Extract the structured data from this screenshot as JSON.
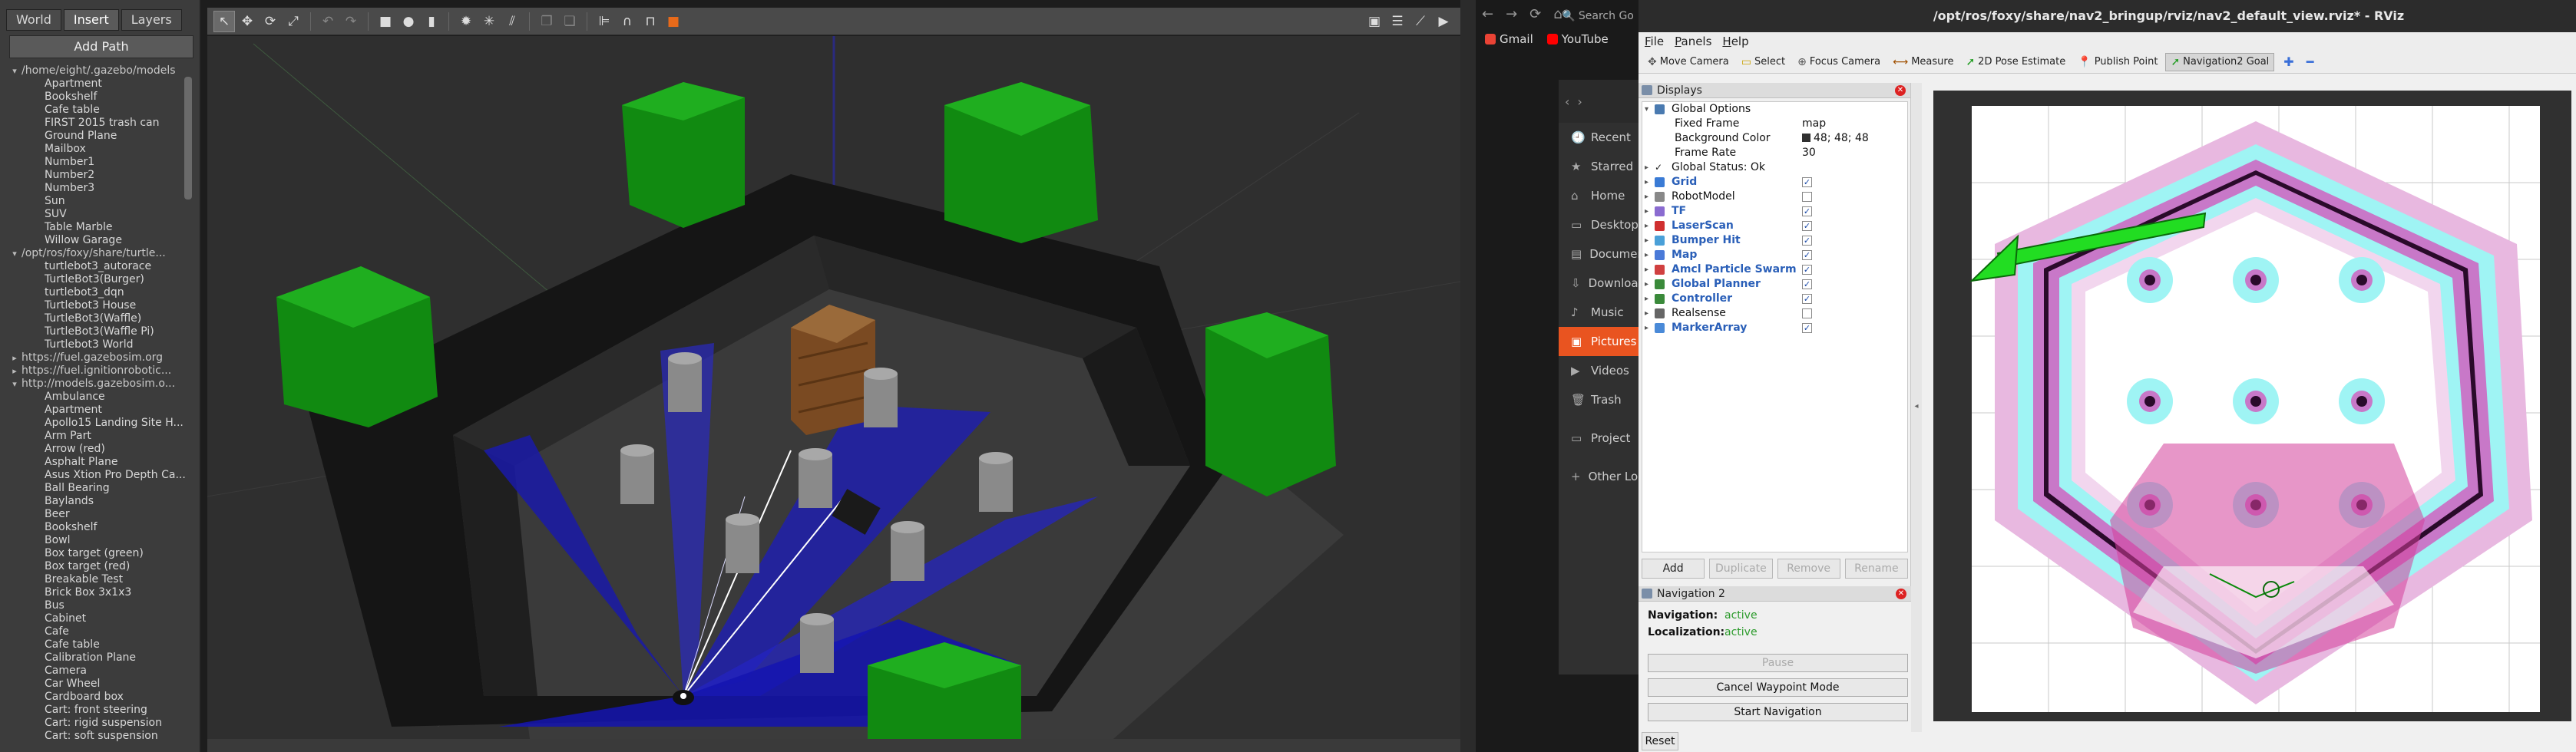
{
  "gazebo": {
    "tabs": [
      {
        "label": "World"
      },
      {
        "label": "Insert"
      },
      {
        "label": "Layers"
      }
    ],
    "add_path_label": "Add Path",
    "tree": [
      {
        "label": "/home/eight/.gazebo/models",
        "root": true
      },
      {
        "label": "Apartment"
      },
      {
        "label": "Bookshelf"
      },
      {
        "label": "Cafe table"
      },
      {
        "label": "FIRST 2015 trash can"
      },
      {
        "label": "Ground Plane"
      },
      {
        "label": "Mailbox"
      },
      {
        "label": "Number1"
      },
      {
        "label": "Number2"
      },
      {
        "label": "Number3"
      },
      {
        "label": "Sun"
      },
      {
        "label": "SUV"
      },
      {
        "label": "Table Marble"
      },
      {
        "label": "Willow Garage"
      },
      {
        "label": "/opt/ros/foxy/share/turtle...",
        "root": true
      },
      {
        "label": "turtlebot3_autorace"
      },
      {
        "label": "TurtleBot3(Burger)"
      },
      {
        "label": "turtlebot3_dqn"
      },
      {
        "label": "Turtlebot3 House"
      },
      {
        "label": "TurtleBot3(Waffle)"
      },
      {
        "label": "TurtleBot3(Waffle Pi)"
      },
      {
        "label": "Turtlebot3 World"
      },
      {
        "label": "https://fuel.gazebosim.org",
        "root": true,
        "collapsed": true
      },
      {
        "label": "https://fuel.ignitionrobotic...",
        "root": true,
        "collapsed": true
      },
      {
        "label": "http://models.gazebosim.o...",
        "root": true
      },
      {
        "label": "Ambulance"
      },
      {
        "label": "Apartment"
      },
      {
        "label": "Apollo15 Landing Site H..."
      },
      {
        "label": "Arm Part"
      },
      {
        "label": "Arrow (red)"
      },
      {
        "label": "Asphalt Plane"
      },
      {
        "label": "Asus Xtion Pro Depth Ca..."
      },
      {
        "label": "Ball Bearing"
      },
      {
        "label": "Baylands"
      },
      {
        "label": "Beer"
      },
      {
        "label": "Bookshelf"
      },
      {
        "label": "Bowl"
      },
      {
        "label": "Box target (green)"
      },
      {
        "label": "Box target (red)"
      },
      {
        "label": "Breakable Test"
      },
      {
        "label": "Brick Box 3x1x3"
      },
      {
        "label": "Bus"
      },
      {
        "label": "Cabinet"
      },
      {
        "label": "Cafe"
      },
      {
        "label": "Cafe table"
      },
      {
        "label": "Calibration Plane"
      },
      {
        "label": "Camera"
      },
      {
        "label": "Car Wheel"
      },
      {
        "label": "Cardboard box"
      },
      {
        "label": "Cart: front steering"
      },
      {
        "label": "Cart: rigid suspension"
      },
      {
        "label": "Cart: soft suspension"
      }
    ],
    "toolbar_icons": [
      "arrow-select-icon",
      "translate-icon",
      "rotate-icon",
      "scale-icon",
      "undo-icon",
      "redo-icon",
      "box-icon",
      "sphere-icon",
      "cylinder-icon",
      "sun-icon",
      "spot-light-icon",
      "dir-light-icon",
      "copy-icon",
      "paste-icon",
      "align-icon",
      "snap-icon",
      "joint-icon",
      "color-icon"
    ],
    "toolbar_right_icons": [
      "screenshot-icon",
      "log-icon",
      "plot-icon",
      "video-icon"
    ]
  },
  "browser": {
    "search_placeholder": "Search Go",
    "bookmarks": [
      {
        "label": "Gmail",
        "color": "#ea4335"
      },
      {
        "label": "YouTube",
        "color": "#ff0000"
      }
    ]
  },
  "files": {
    "sidebar": [
      {
        "label": "Recent",
        "icon": "clock-icon"
      },
      {
        "label": "Starred",
        "icon": "star-icon"
      },
      {
        "label": "Home",
        "icon": "home-icon"
      },
      {
        "label": "Desktop",
        "icon": "desktop-icon"
      },
      {
        "label": "Documents",
        "icon": "document-icon"
      },
      {
        "label": "Downloads",
        "icon": "download-icon"
      },
      {
        "label": "Music",
        "icon": "music-icon"
      },
      {
        "label": "Pictures",
        "icon": "pictures-icon",
        "active": true
      },
      {
        "label": "Videos",
        "icon": "video-icon"
      },
      {
        "label": "Trash",
        "icon": "trash-icon"
      },
      {
        "label": "Project",
        "icon": "folder-icon"
      },
      {
        "label": "Other Locations",
        "icon": "plus-icon"
      }
    ]
  },
  "rviz": {
    "title": "/opt/ros/foxy/share/nav2_bringup/rviz/nav2_default_view.rviz* - RViz",
    "menu": [
      "File",
      "Panels",
      "Help"
    ],
    "tools": [
      {
        "label": "Move Camera",
        "icon": "move-camera-icon"
      },
      {
        "label": "Select",
        "icon": "select-icon"
      },
      {
        "label": "Focus Camera",
        "icon": "focus-camera-icon"
      },
      {
        "label": "Measure",
        "icon": "measure-icon"
      },
      {
        "label": "2D Pose Estimate",
        "icon": "pose-estimate-icon"
      },
      {
        "label": "Publish Point",
        "icon": "publish-point-icon"
      },
      {
        "label": "Navigation2 Goal",
        "icon": "nav-goal-icon",
        "active": true
      }
    ],
    "displays_title": "Displays",
    "displays": [
      {
        "label": "Global Options",
        "expanded": true
      },
      {
        "label": "Fixed Frame",
        "value": "map",
        "sub": true
      },
      {
        "label": "Background Color",
        "value": "48; 48; 48",
        "sub": true,
        "swatch": "#303030"
      },
      {
        "label": "Frame Rate",
        "value": "30",
        "sub": true
      },
      {
        "label": "Global Status: Ok",
        "status": true
      },
      {
        "label": "Grid",
        "checked": true,
        "color": "#3a7bd5"
      },
      {
        "label": "RobotModel",
        "checked": false,
        "plain": true,
        "color": "#888888"
      },
      {
        "label": "TF",
        "checked": true,
        "color": "#8a6bd0"
      },
      {
        "label": "LaserScan",
        "checked": true,
        "color": "#d03030"
      },
      {
        "label": "Bumper Hit",
        "checked": true,
        "color": "#4aa0d8"
      },
      {
        "label": "Map",
        "checked": true,
        "color": "#4a7ad8"
      },
      {
        "label": "Amcl Particle Swarm",
        "checked": true,
        "color": "#d04040"
      },
      {
        "label": "Global Planner",
        "checked": true,
        "color": "#3a8a3a"
      },
      {
        "label": "Controller",
        "checked": true,
        "color": "#3a8a3a"
      },
      {
        "label": "Realsense",
        "checked": false,
        "plain": true,
        "color": "#666666"
      },
      {
        "label": "MarkerArray",
        "checked": true,
        "color": "#4a8ad8"
      }
    ],
    "display_buttons": [
      {
        "label": "Add",
        "disabled": false
      },
      {
        "label": "Duplicate",
        "disabled": true
      },
      {
        "label": "Remove",
        "disabled": true
      },
      {
        "label": "Rename",
        "disabled": true
      }
    ],
    "nav2": {
      "title": "Navigation 2",
      "navigation_label": "Navigation:",
      "navigation_value": "active",
      "localization_label": "Localization:",
      "localization_value": "active",
      "pause_label": "Pause",
      "waypoint_label": "Cancel Waypoint Mode",
      "start_label": "Start Navigation"
    },
    "reset_label": "Reset"
  }
}
